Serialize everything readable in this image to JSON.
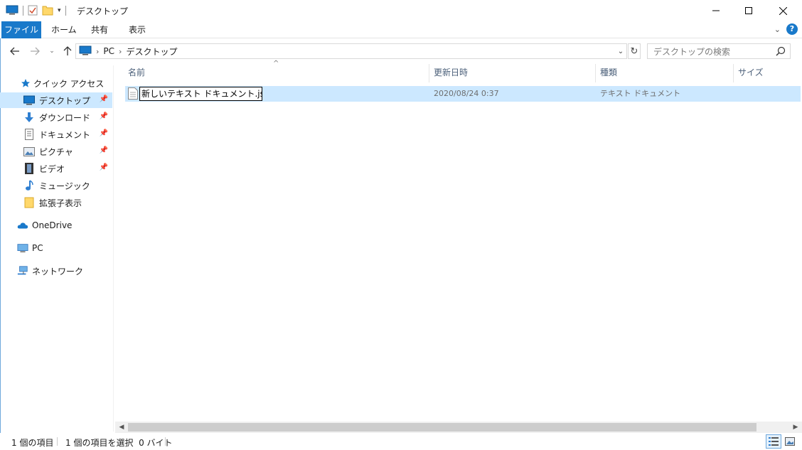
{
  "window": {
    "title": "デスクトップ"
  },
  "ribbon": {
    "tabs": [
      "ファイル",
      "ホーム",
      "共有",
      "表示"
    ]
  },
  "address": {
    "crumbs": [
      "PC",
      "デスクトップ"
    ],
    "search_placeholder": "デスクトップの検索"
  },
  "sidebar": {
    "quick_access": "クイック アクセス",
    "items": [
      {
        "label": "デスクトップ",
        "icon": "desktop-icon",
        "pinned": true
      },
      {
        "label": "ダウンロード",
        "icon": "download-icon",
        "pinned": true
      },
      {
        "label": "ドキュメント",
        "icon": "document-icon",
        "pinned": true
      },
      {
        "label": "ピクチャ",
        "icon": "picture-icon",
        "pinned": true
      },
      {
        "label": "ビデオ",
        "icon": "video-icon",
        "pinned": true
      },
      {
        "label": "ミュージック",
        "icon": "music-icon",
        "pinned": false
      },
      {
        "label": "拡張子表示",
        "icon": "folder-icon",
        "pinned": false
      }
    ],
    "onedrive": "OneDrive",
    "pc": "PC",
    "network": "ネットワーク"
  },
  "list": {
    "columns": [
      "名前",
      "更新日時",
      "種類",
      "サイズ"
    ],
    "rows": [
      {
        "name": "新しいテキスト ドキュメント.json",
        "modified": "2020/08/24 0:37",
        "type": "テキスト ドキュメント",
        "size": ""
      }
    ]
  },
  "status": {
    "item_count": "1 個の項目",
    "selection": "1 個の項目を選択  0 バイト"
  },
  "colors": {
    "accent": "#1979ca",
    "selection": "#cce8ff"
  }
}
